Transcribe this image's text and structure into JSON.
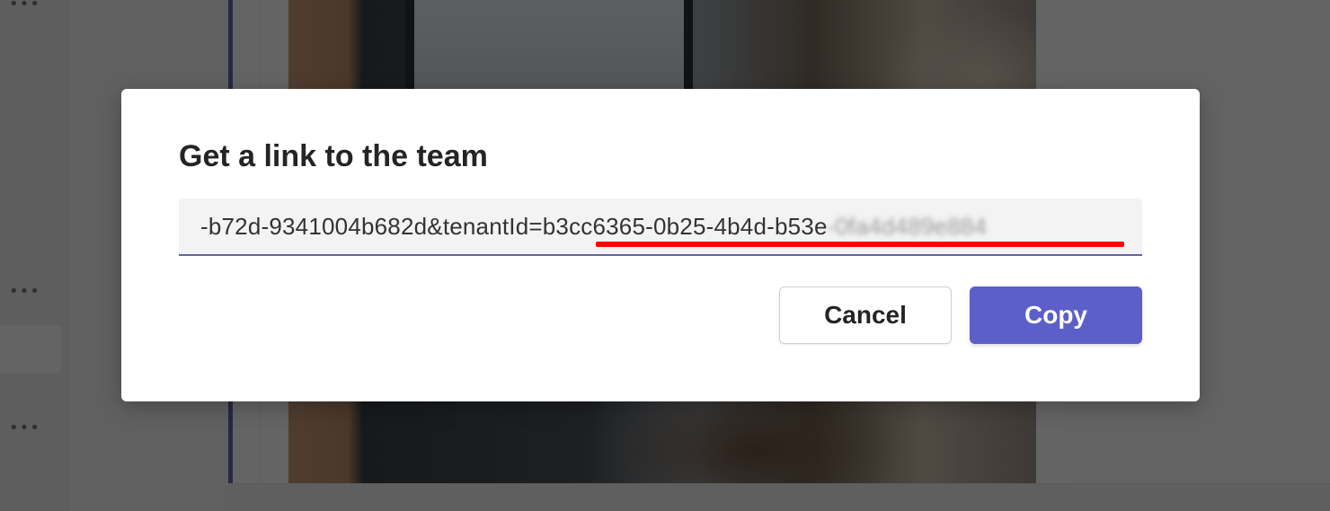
{
  "background": {
    "more_options": "•••"
  },
  "dialog": {
    "title": "Get a link to the team",
    "link_visible_text": "-b72d-9341004b682d&tenantId=b3cc6365-0b25-4b4d-b53e",
    "link_obscured_text": "-0fa4d489e884",
    "cancel_label": "Cancel",
    "copy_label": "Copy"
  },
  "colors": {
    "accent": "#6264a7",
    "primary_button": "#5b5fc7",
    "annotation_underline": "#ff0000"
  }
}
